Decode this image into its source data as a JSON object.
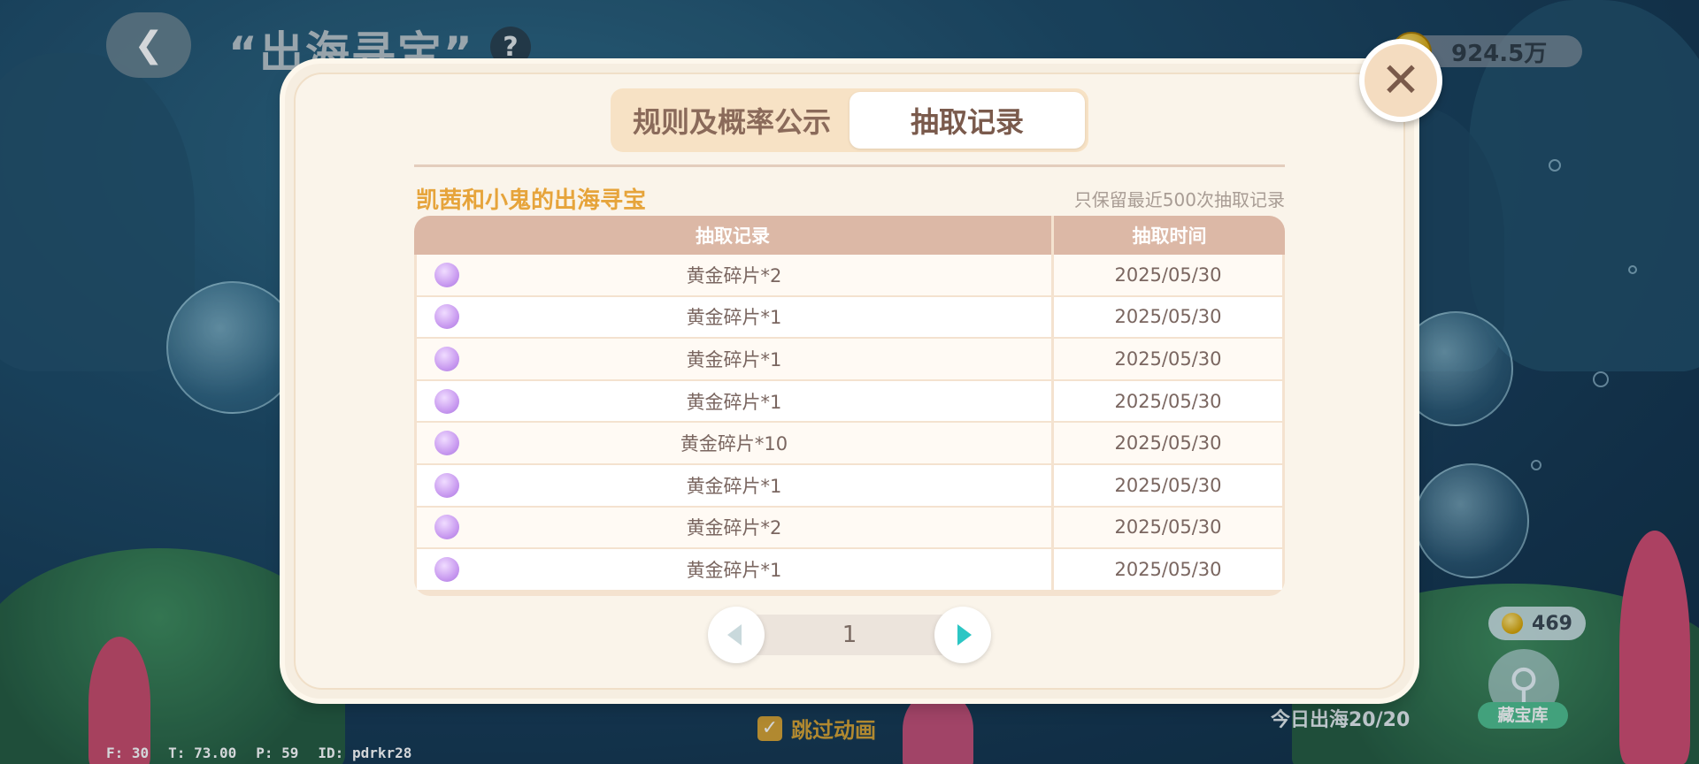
{
  "header": {
    "title": "“出海寻宝”",
    "help_label": "?",
    "back_icon": "chevron-left-icon",
    "currency_value": "924.5万"
  },
  "modal": {
    "tabs": [
      {
        "label": "规则及概率公示",
        "active": false
      },
      {
        "label": "抽取记录",
        "active": true
      }
    ],
    "close_icon": "close-icon",
    "record_title": "凯茜和小鬼的出海寻宝",
    "record_note": "只保留最近500次抽取记录",
    "table": {
      "headers": [
        "抽取记录",
        "抽取时间"
      ],
      "rows": [
        {
          "item": "黄金碎片*2",
          "time": "2025/05/30"
        },
        {
          "item": "黄金碎片*1",
          "time": "2025/05/30"
        },
        {
          "item": "黄金碎片*1",
          "time": "2025/05/30"
        },
        {
          "item": "黄金碎片*1",
          "time": "2025/05/30"
        },
        {
          "item": "黄金碎片*10",
          "time": "2025/05/30"
        },
        {
          "item": "黄金碎片*1",
          "time": "2025/05/30"
        },
        {
          "item": "黄金碎片*2",
          "time": "2025/05/30"
        },
        {
          "item": "黄金碎片*1",
          "time": "2025/05/30"
        }
      ]
    },
    "pager": {
      "page": "1"
    }
  },
  "side": {
    "gem_count": "469",
    "treasury_label": "藏宝库",
    "daily_count": "今日出海20/20"
  },
  "bottom": {
    "skip_label": "跳过动画",
    "skip_checked": true,
    "debug": {
      "f": "F: 30",
      "t": "T: 73.00",
      "p": "P: 59",
      "id": "ID: pdrkr28"
    }
  },
  "colors": {
    "accent_orange": "#e6a43b",
    "modal_bg": "#f6eee1",
    "table_header": "#dcb8a6",
    "pager_next": "#2cc6c4",
    "treasury_green": "#4fbf8e"
  }
}
